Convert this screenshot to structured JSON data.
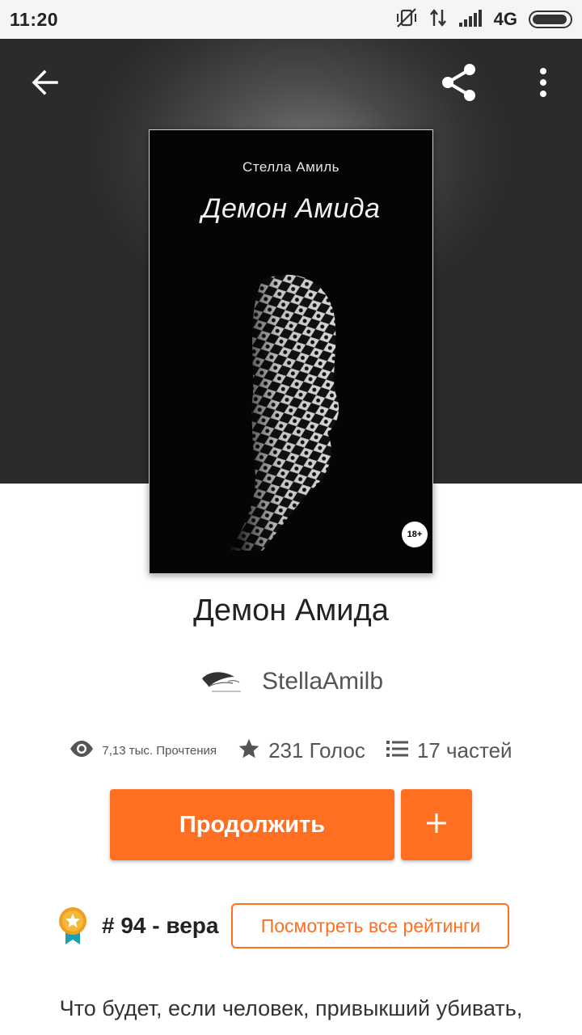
{
  "status_bar": {
    "time": "11:20",
    "network": "4G",
    "battery_percent": 95,
    "icons": [
      "vibrate-off-icon",
      "data-transfer-icon",
      "signal-icon",
      "battery-icon"
    ]
  },
  "toolbar": {
    "back_icon": "arrow-back-icon",
    "share_icon": "share-icon",
    "more_icon": "more-vert-icon"
  },
  "cover": {
    "author": "Стелла Амиль",
    "title": "Демон Амида",
    "age_rating": "18+"
  },
  "story": {
    "title": "Демон Амида",
    "author_name": "StellaAmilb"
  },
  "stats": {
    "reads": "7,13 тыс. Прочтения",
    "votes": "231 Голос",
    "parts": "17 частей"
  },
  "actions": {
    "continue_label": "Продолжить",
    "add_icon": "plus-icon"
  },
  "ranking": {
    "text": "# 94 - вера",
    "all_rankings_label": "Посмотреть все рейтинги"
  },
  "description": {
    "first_line": "Что будет, если человек, привыкший убивать,"
  },
  "colors": {
    "accent": "#ff6f22",
    "text_primary": "#222222",
    "text_secondary": "#555555"
  }
}
